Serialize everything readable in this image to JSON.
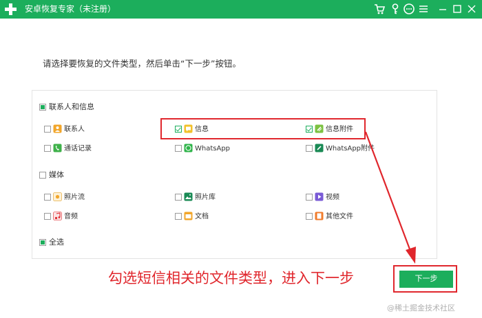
{
  "window": {
    "title": "安卓恢复专家（未注册）",
    "icons": [
      "cart-icon",
      "key-icon",
      "chat-icon",
      "menu-icon",
      "minimize-icon",
      "maximize-icon",
      "close-icon"
    ]
  },
  "instruction": "请选择要恢复的文件类型，然后单击“下一步”按钮。",
  "groups": {
    "contacts_messages": {
      "label": "联系人和信息",
      "state": "partial",
      "items": {
        "contacts": {
          "label": "联系人",
          "checked": false,
          "icon": "contacts-icon"
        },
        "messages": {
          "label": "信息",
          "checked": true,
          "icon": "message-icon"
        },
        "message_attachments": {
          "label": "信息附件",
          "checked": true,
          "icon": "attachment-icon"
        },
        "call_log": {
          "label": "通话记录",
          "checked": false,
          "icon": "phone-icon"
        },
        "whatsapp": {
          "label": "WhatsApp",
          "checked": false,
          "icon": "whatsapp-icon"
        },
        "whatsapp_attachments": {
          "label": "WhatsApp附件",
          "checked": false,
          "icon": "whatsapp-attachment-icon"
        }
      }
    },
    "media": {
      "label": "媒体",
      "state": "unchecked",
      "items": {
        "camera_roll": {
          "label": "照片流",
          "checked": false,
          "icon": "photo-stream-icon"
        },
        "photo_library": {
          "label": "照片库",
          "checked": false,
          "icon": "photo-library-icon"
        },
        "video": {
          "label": "视频",
          "checked": false,
          "icon": "video-icon"
        },
        "audio": {
          "label": "音频",
          "checked": false,
          "icon": "audio-icon"
        },
        "documents": {
          "label": "文档",
          "checked": false,
          "icon": "folder-icon"
        },
        "other_files": {
          "label": "其他文件",
          "checked": false,
          "icon": "file-icon"
        }
      }
    },
    "select_all": {
      "label": "全选",
      "state": "partial"
    }
  },
  "annotation": "勾选短信相关的文件类型，进入下一步",
  "next_button": "下一步",
  "watermark": "@稀土掘金技术社区",
  "colors": {
    "brand": "#1cae5c",
    "annotation_red": "#e0262c"
  }
}
